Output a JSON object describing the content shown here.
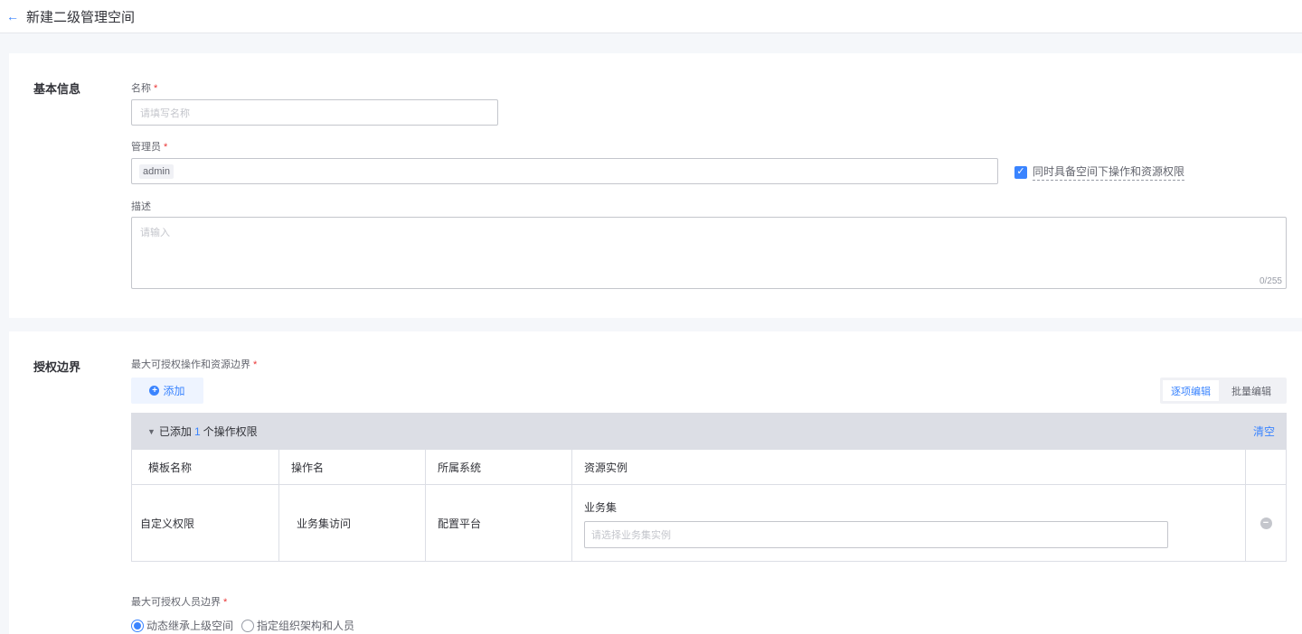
{
  "header": {
    "back_icon": "arrow-left-icon",
    "title": "新建二级管理空间"
  },
  "basic": {
    "section_title": "基本信息",
    "name_label": "名称",
    "name_placeholder": "请填写名称",
    "admin_label": "管理员",
    "admin_value": "admin",
    "checkbox_label": "同时具备空间下操作和资源权限",
    "checkbox_checked": true,
    "desc_label": "描述",
    "desc_placeholder": "请输入",
    "desc_count": "0/255",
    "required_mark": "*"
  },
  "auth": {
    "section_title": "授权边界",
    "max_ops_label": "最大可授权操作和资源边界",
    "add_label": "添加",
    "mode_options": [
      "逐项编辑",
      "批量编辑"
    ],
    "mode_selected": "逐项编辑",
    "summary_prefix": "已添加",
    "summary_count": "1",
    "summary_suffix": "个操作权限",
    "clear_label": "清空",
    "columns": [
      "模板名称",
      "操作名",
      "所属系统",
      "资源实例",
      ""
    ],
    "rows": [
      {
        "template": "自定义权限",
        "action": "业务集访问",
        "system": "配置平台",
        "resource_label": "业务集",
        "resource_placeholder": "请选择业务集实例"
      }
    ],
    "max_users_label": "最大可授权人员边界",
    "radio_options": [
      "动态继承上级空间",
      "指定组织架构和人员"
    ],
    "radio_selected": "动态继承上级空间"
  },
  "colors": {
    "primary": "#3a84ff",
    "required": "#ea3636",
    "border": "#c4c6cc"
  }
}
